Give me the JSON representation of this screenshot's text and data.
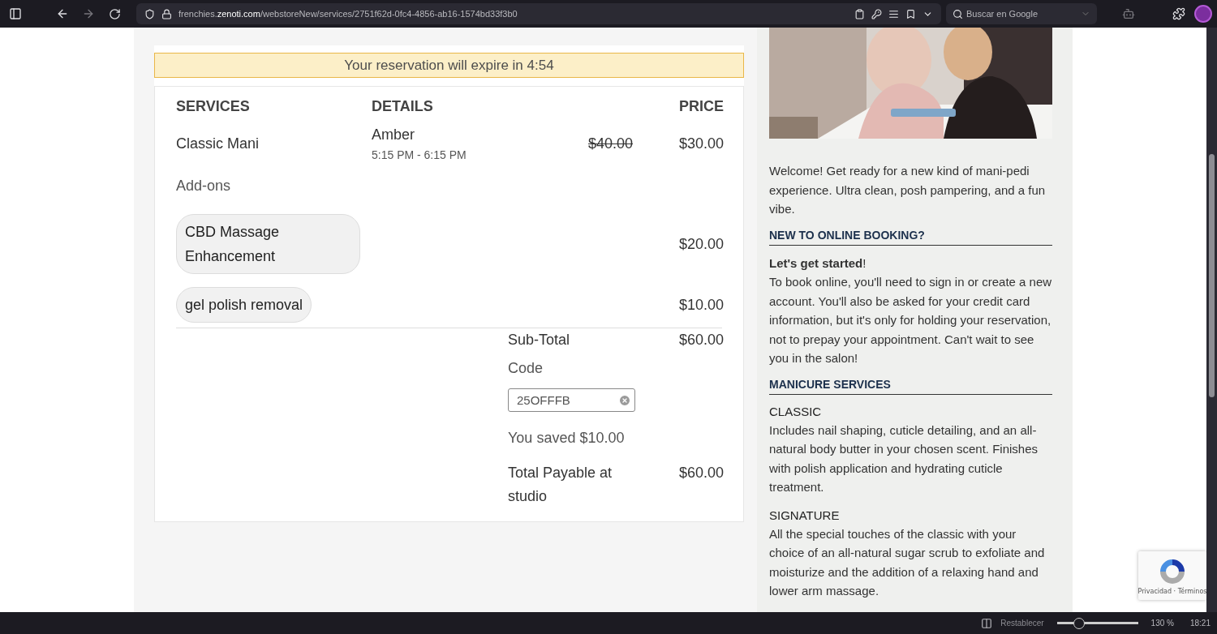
{
  "browser": {
    "url": "frenchies.**zenoti.com**/webstoreNew/services/2751f62d-0fc4-4856-ab16-1574bd33f3b0",
    "forward": {
      "disabled": true
    },
    "search_placeholder": "Buscar en Google"
  },
  "timer": "Your reservation will expire in 4:54",
  "table": {
    "columns": [
      "SERVICES",
      "DETAILS",
      "PRICE"
    ],
    "service": {
      "name": "Classic Mani",
      "staff": "Amber",
      "time": "5:15 PM - 6:15 PM",
      "original_price": "$40.00",
      "price": "$30.00"
    },
    "addons_label": "Add-ons",
    "addons": [
      {
        "name": "CBD Massage Enhancement",
        "price": "$20.00"
      },
      {
        "name": "gel polish removal",
        "price": "$10.00"
      }
    ],
    "summary": {
      "subtotal_label": "Sub-Total",
      "subtotal": "$60.00",
      "code_label": "Code",
      "code_value": "25OFFFB",
      "saved": "You saved $10.00",
      "total_label": "Total Payable at studio",
      "total": "$60.00"
    }
  },
  "sidebar": [
    {
      "kind": "paragraph",
      "text": "Welcome! Get ready for a new kind of mani-pedi experience. Ultra clean, posh pampering, and a fun vibe."
    },
    {
      "kind": "heading",
      "text": "NEW TO ONLINE BOOKING?"
    },
    {
      "kind": "lead",
      "text": "**Let's get started**!"
    },
    {
      "kind": "paragraph",
      "text": "To book online, you'll need to sign in or create a new account. You'll also be asked for your credit card information, but it's only for holding your reservation, not to prepay your appointment. Can't wait to see you in the salon!"
    },
    {
      "kind": "heading",
      "text": "MANICURE SERVICES"
    },
    {
      "kind": "subheading",
      "text": "CLASSIC"
    },
    {
      "kind": "paragraph",
      "text": "Includes nail shaping, cuticle detailing, and an all-natural body butter in your chosen scent. Finishes with polish application and hydrating cuticle treatment."
    },
    {
      "kind": "subheading",
      "text": "SIGNATURE"
    },
    {
      "kind": "paragraph",
      "text": "All the special touches of the classic with your choice of an all-natural sugar scrub to exfoliate and moisturize and the addition of a relaxing hand and lower arm massage."
    }
  ],
  "recaptcha": {
    "links": "Privacidad · Términos"
  },
  "status_bar": {
    "reset": "Restablecer",
    "zoom": {
      "level": 0.25
    },
    "zoom_label": "130 %",
    "time": "18:21"
  }
}
